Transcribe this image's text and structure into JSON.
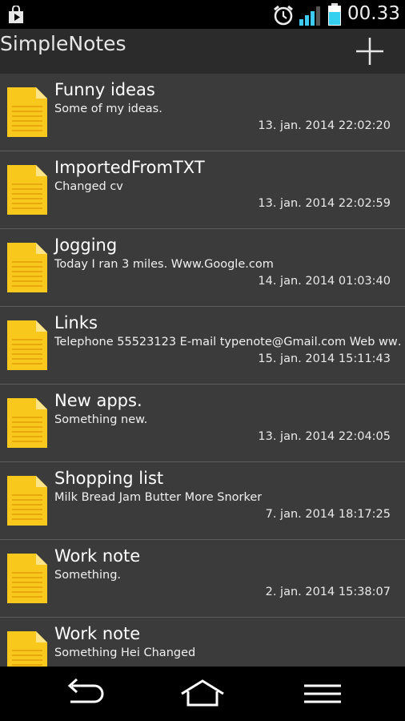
{
  "status": {
    "time": "00.33",
    "icons": [
      "play-store-notification-icon",
      "alarm-icon",
      "signal-icon",
      "battery-icon"
    ],
    "signal_color": "#3ecbf2",
    "battery_color": "#35d0f0"
  },
  "app": {
    "title": "SimpleNotes",
    "add_icon": "plus-icon"
  },
  "notes": [
    {
      "title": "Funny ideas",
      "preview": "Some of my ideas.",
      "date": "13. jan. 2014 22:02:20"
    },
    {
      "title": "ImportedFromTXT",
      "preview": "Changed cv",
      "date": "13. jan. 2014 22:02:59"
    },
    {
      "title": "Jogging",
      "preview": "Today I ran 3 miles.  Www.Google.com",
      "date": "14. jan. 2014 01:03:40"
    },
    {
      "title": "Links",
      "preview": "Telephone 55523123  E-mail typenote@Gmail.com   Web ww…",
      "date": "15. jan. 2014 15:11:43"
    },
    {
      "title": "New apps.",
      "preview": "Something new.",
      "date": "13. jan. 2014 22:04:05"
    },
    {
      "title": "Shopping list",
      "preview": "Milk Bread Jam Butter More Snorker",
      "date": "7. jan. 2014 18:17:25"
    },
    {
      "title": "Work note",
      "preview": "Something.",
      "date": "2. jan. 2014 15:38:07"
    },
    {
      "title": "Work note",
      "preview": "Something  Hei Changed",
      "date": ""
    }
  ],
  "navbar": {
    "icons": [
      "back-icon",
      "home-icon",
      "menu-icon"
    ]
  },
  "colors": {
    "note_icon": "#f8c81c",
    "list_bg": "#3b3b3b",
    "divider": "#5c5c5c"
  }
}
